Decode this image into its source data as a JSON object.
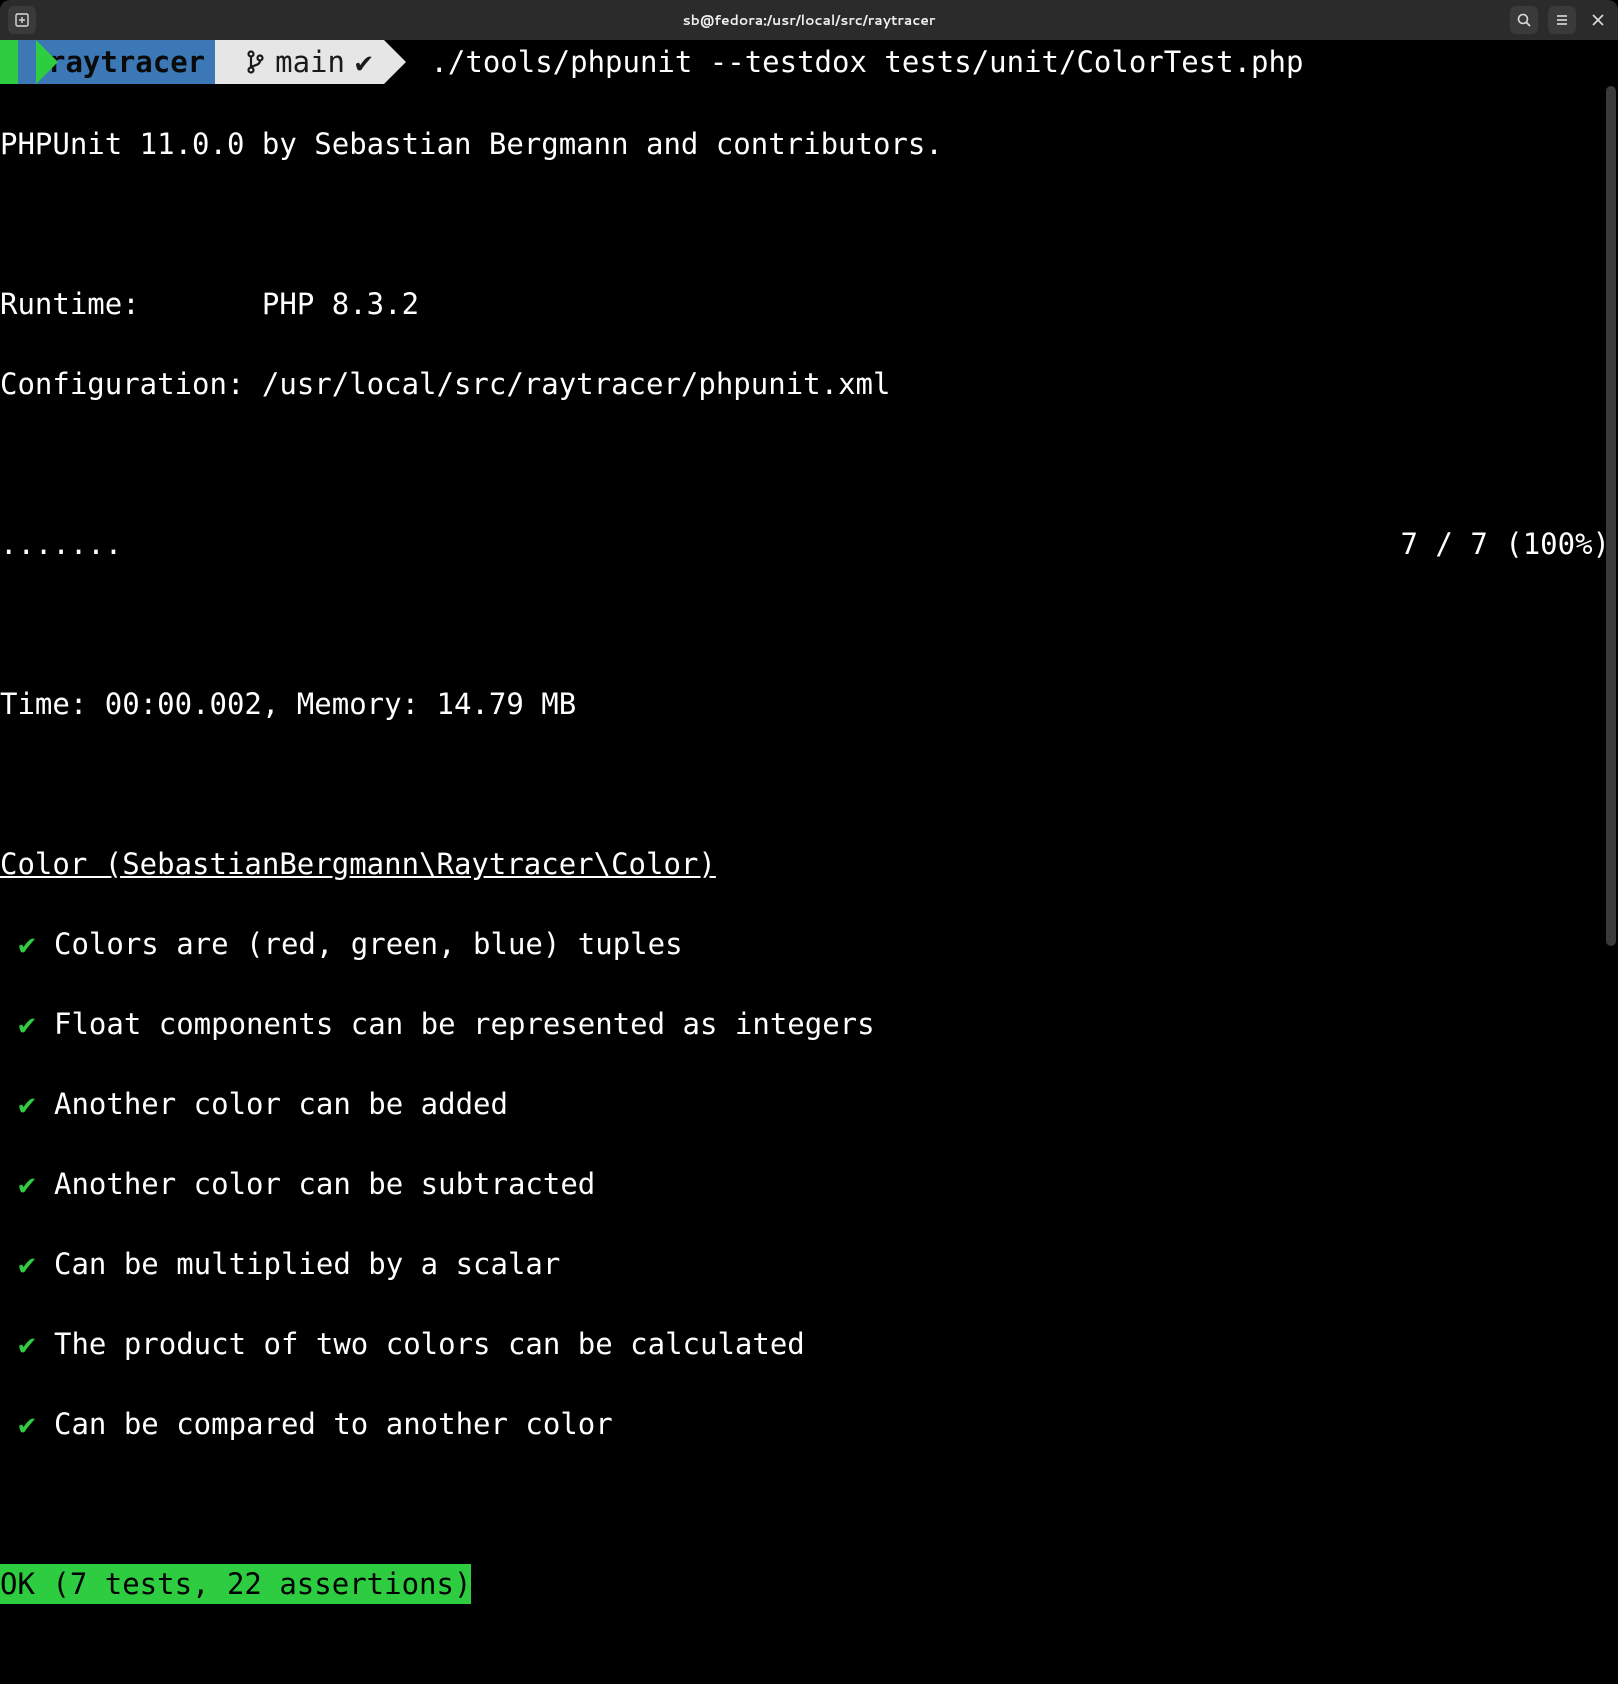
{
  "window": {
    "title": "sb@fedora:/usr/local/src/raytracer"
  },
  "prompt": {
    "dir": "raytracer",
    "branch": "main",
    "branch_status": "✔",
    "command": "./tools/phpunit --testdox tests/unit/ColorTest.php"
  },
  "output": {
    "banner": "PHPUnit 11.0.0 by Sebastian Bergmann and contributors.",
    "runtime_label": "Runtime:",
    "runtime_value": "PHP 8.3.2",
    "config_label": "Configuration:",
    "config_value": "/usr/local/src/raytracer/phpunit.xml",
    "dots": ".......",
    "progress": "7 / 7 (100%)",
    "time_memory": "Time: 00:00.002, Memory: 14.79 MB",
    "suite_header": "Color (SebastianBergmann\\Raytracer\\Color)",
    "tests": [
      "Colors are (red, green, blue) tuples",
      "Float components can be represented as integers",
      "Another color can be added",
      "Another color can be subtracted",
      "Can be multiplied by a scalar",
      "The product of two colors can be calculated",
      "Can be compared to another color"
    ],
    "ok_line": "OK (7 tests, 22 assertions)"
  }
}
